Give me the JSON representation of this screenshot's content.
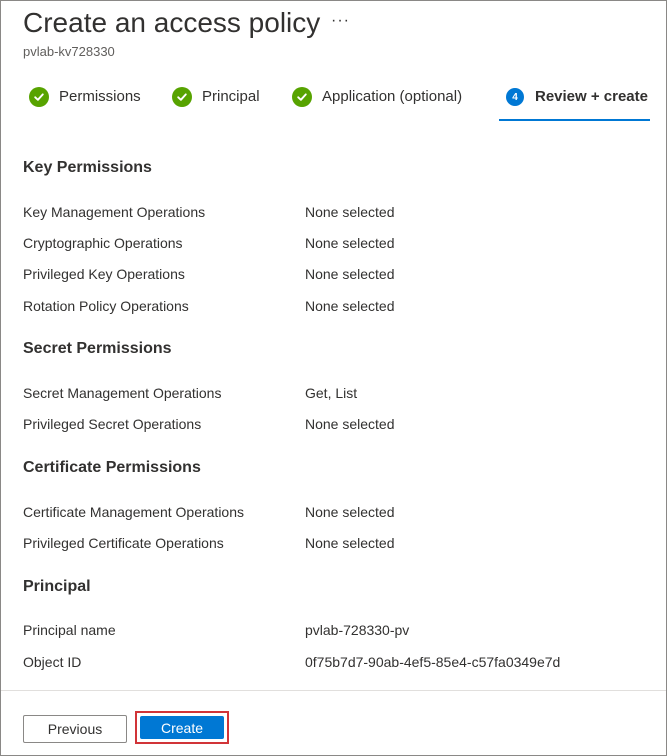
{
  "header": {
    "title": "Create an access policy",
    "more_label": "···",
    "subtitle": "pvlab-kv728330"
  },
  "tabs": [
    {
      "label": "Permissions",
      "state": "complete"
    },
    {
      "label": "Principal",
      "state": "complete"
    },
    {
      "label": "Application (optional)",
      "state": "complete"
    },
    {
      "label": "Review + create",
      "state": "active",
      "step": "4"
    }
  ],
  "sections": {
    "key": {
      "title": "Key Permissions",
      "rows": [
        {
          "label": "Key Management Operations",
          "value": "None selected"
        },
        {
          "label": "Cryptographic Operations",
          "value": "None selected"
        },
        {
          "label": "Privileged Key Operations",
          "value": "None selected"
        },
        {
          "label": "Rotation Policy Operations",
          "value": "None selected"
        }
      ]
    },
    "secret": {
      "title": "Secret Permissions",
      "rows": [
        {
          "label": "Secret Management Operations",
          "value": "Get, List"
        },
        {
          "label": "Privileged Secret Operations",
          "value": "None selected"
        }
      ]
    },
    "certificate": {
      "title": "Certificate Permissions",
      "rows": [
        {
          "label": "Certificate Management Operations",
          "value": "None selected"
        },
        {
          "label": "Privileged Certificate Operations",
          "value": "None selected"
        }
      ]
    },
    "principal": {
      "title": "Principal",
      "rows": [
        {
          "label": "Principal name",
          "value": "pvlab-728330-pv"
        },
        {
          "label": "Object ID",
          "value": "0f75b7d7-90ab-4ef5-85e4-c57fa0349e7d"
        }
      ]
    }
  },
  "footer": {
    "previous_label": "Previous",
    "create_label": "Create"
  },
  "colors": {
    "accent": "#0078d4",
    "success": "#57a300",
    "highlight": "#d13438"
  },
  "icons": {
    "complete": "checkmark-circle-icon",
    "more": "more-options-icon"
  }
}
